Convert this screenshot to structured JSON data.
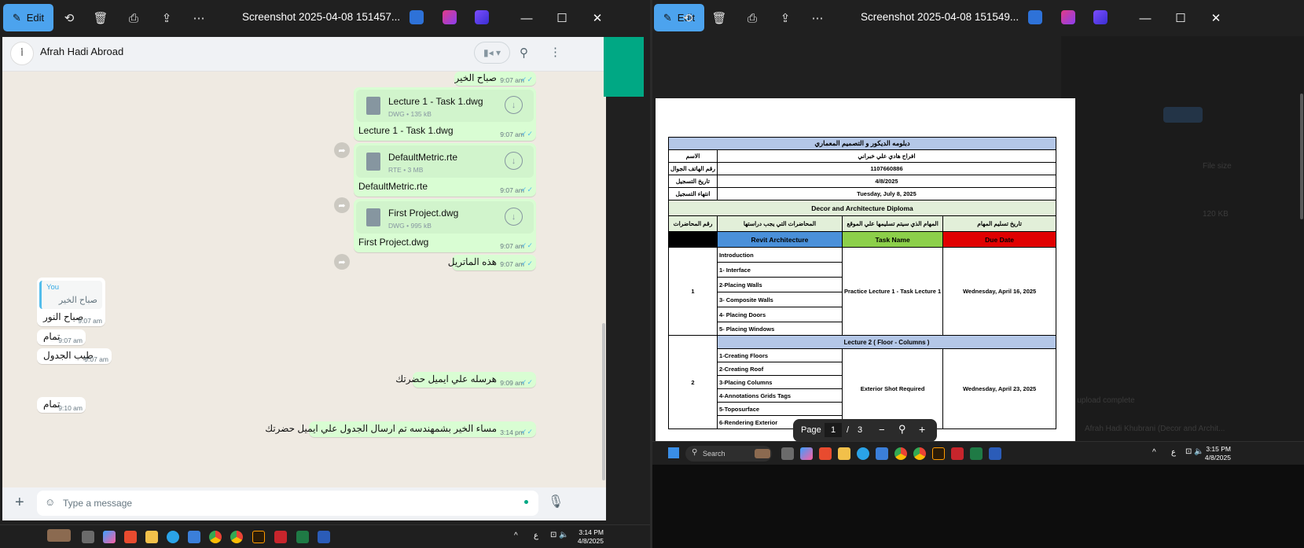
{
  "left_window": {
    "edit_label": "Edit",
    "title": "Screenshot 2025-04-08 151457...",
    "chat": {
      "contact_name": "Afrah Hadi Abroad",
      "messages": [
        {
          "dir": "out",
          "text": "صباح الخير",
          "time": "9:07 am"
        },
        {
          "dir": "out",
          "file_name": "Lecture 1 - Task 1.dwg",
          "file_meta": "DWG • 135 kB",
          "caption": "Lecture 1 - Task 1.dwg",
          "time": "9:07 am"
        },
        {
          "dir": "out",
          "file_name": "DefaultMetric.rte",
          "file_meta": "RTE • 3 MB",
          "caption": "DefaultMetric.rte",
          "time": "9:07 am"
        },
        {
          "dir": "out",
          "file_name": "First Project.dwg",
          "file_meta": "DWG • 995 kB",
          "caption": "First Project.dwg",
          "time": "9:07 am"
        },
        {
          "dir": "out",
          "text": "هذه الماتريل",
          "time": "9:07 am"
        },
        {
          "dir": "in",
          "quote_author": "You",
          "quote_text": "صباح الخير",
          "text": "صباح النور",
          "time": "9:07 am"
        },
        {
          "dir": "in",
          "text": "تمام",
          "time": "9:07 am"
        },
        {
          "dir": "in",
          "text": "طيب الجدول",
          "time": "9:07 am"
        },
        {
          "dir": "out",
          "text": "هرسله علي ايميل حضرتك",
          "time": "9:09 am"
        },
        {
          "dir": "in",
          "text": "تمام",
          "time": "9:10 am"
        },
        {
          "dir": "out",
          "text": "مساء الخير بشمهندسه تم ارسال الجدول علي ايميل حضرتك",
          "time": "3:14 pm"
        }
      ],
      "composer_placeholder": "Type a message"
    },
    "taskbar": {
      "clock_time": "3:14 PM",
      "clock_date": "4/8/2025",
      "lang": "ع"
    }
  },
  "right_window": {
    "edit_label": "Edit",
    "title": "Screenshot 2025-04-08 151549...",
    "pdf": {
      "heading": "دبلومه الديكور و التصميم المعماري",
      "rows": [
        {
          "label": "الاسم",
          "value": "افراح هادي علي خبراني"
        },
        {
          "label": "رقم الهاتف الجوال",
          "value": "1107660886"
        },
        {
          "label": "تاريخ التسجيل",
          "value": "4/8/2025"
        },
        {
          "label": "انتهاء التسجيل",
          "value": "Tuesday, July 8, 2025"
        }
      ],
      "program": "Decor and Architecture Diploma",
      "col_headers": [
        "تاريخ تسليم المهام",
        "المهام الذي سيتم تسليمها علي الموقع",
        "المحاضرات التي يجب دراستها",
        "رقم المحاضرات"
      ],
      "sub_headers": {
        "course": "Revit Architecture",
        "task": "Task Name",
        "due": "Due Date"
      },
      "lecture1": {
        "num": "1",
        "items": [
          "Introduction",
          "1- Interface",
          "2-Placing Walls",
          "3- Composite Walls",
          "4- Placing Doors",
          "5- Placing Windows"
        ],
        "task": "Practice Lecture 1 - Task Lecture 1",
        "due": "Wednesday, April 16, 2025"
      },
      "lecture2": {
        "title": "Lecture 2 ( Floor - Columns )",
        "num": "2",
        "items": [
          "1-Creating Floors",
          "2-Creating Roof",
          "3-Placing Columns",
          "4-Annotations Grids Tags",
          "5-Toposurface",
          "6-Rendering Exterior"
        ],
        "task": "Exterior Shot Required",
        "due": "Wednesday, April 23, 2025"
      },
      "page_label": "Page",
      "page_current": "1",
      "page_sep": "/",
      "page_total": "3"
    },
    "background": {
      "file_size_label": "File size",
      "size_value": "120 KB",
      "upload_text": "1 upload complete",
      "upload_file": "Afrah Hadi Khubrani (Decor and Archit..."
    },
    "taskbar": {
      "search_label": "Search",
      "clock_time": "3:15 PM",
      "clock_date": "4/8/2025",
      "lang": "ع"
    }
  },
  "colors": {
    "wa_outgoing": "#d9fdd3",
    "wa_green": "#00a884",
    "edit_button": "#4ca3ee",
    "revit_blue": "#4a90d9",
    "task_green": "#8ccf4a",
    "due_red": "#e00000",
    "header_blue": "#b4c7e7",
    "header_green": "#e2efd9"
  }
}
